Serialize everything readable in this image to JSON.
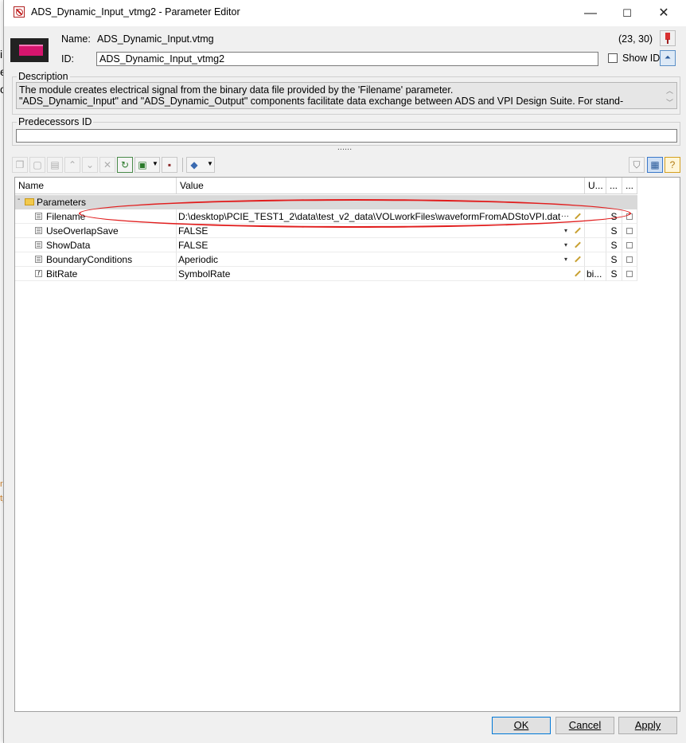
{
  "window": {
    "title": "ADS_Dynamic_Input_vtmg2 - Parameter Editor",
    "controls": {
      "minimize": "—",
      "maximize": "☐",
      "close": "✕"
    }
  },
  "module": {
    "name_label": "Name:",
    "name_value": "ADS_Dynamic_Input.vtmg",
    "coords": "(23, 30)",
    "id_label": "ID:",
    "id_value": "ADS_Dynamic_Input_vtmg2",
    "show_id_label": "Show ID",
    "show_id_checked": false
  },
  "description": {
    "title": "Description",
    "line1": "The module creates electrical signal from the binary data file provided by the 'Filename' parameter.",
    "line2": "\"ADS_Dynamic_Input\" and \"ADS_Dynamic_Output\" components facilitate data exchange between ADS and VPI Design Suite. For stand-"
  },
  "predecessors": {
    "title": "Predecessors ID",
    "value": ""
  },
  "splitter_glyph": "......",
  "grid": {
    "columns": [
      "Name",
      "Value",
      "U...",
      "...",
      "..."
    ],
    "group": {
      "label": "Parameters",
      "expander": "-"
    },
    "rows": [
      {
        "name": "Filename",
        "value": "D:\\desktop\\PCIE_TEST1_2\\data\\test_v2_data\\VOLworkFiles\\waveformFromADStoVPI.dat",
        "ellipsis": "···",
        "unit": "",
        "scope": "S",
        "icon": "list"
      },
      {
        "name": "UseOverlapSave",
        "value": "FALSE",
        "unit": "",
        "scope": "S",
        "icon": "list"
      },
      {
        "name": "ShowData",
        "value": "FALSE",
        "unit": "",
        "scope": "S",
        "icon": "list"
      },
      {
        "name": "BoundaryConditions",
        "value": "Aperiodic",
        "unit": "",
        "scope": "S",
        "icon": "list"
      },
      {
        "name": "BitRate",
        "value": "SymbolRate",
        "unit": "bi...",
        "scope": "S",
        "icon": "f"
      }
    ]
  },
  "buttons": {
    "ok": "OK",
    "cancel": "Cancel",
    "apply": "Apply"
  },
  "colors": {
    "annotation": "#e11d1d",
    "group_row": "#d9d9d9",
    "dialog_bg": "#f0f0f0"
  },
  "background_fragments": [
    "ir",
    "e",
    "o",
    "h",
    "l",
    "ra",
    "tp",
    "ss",
    "pe",
    "c"
  ]
}
